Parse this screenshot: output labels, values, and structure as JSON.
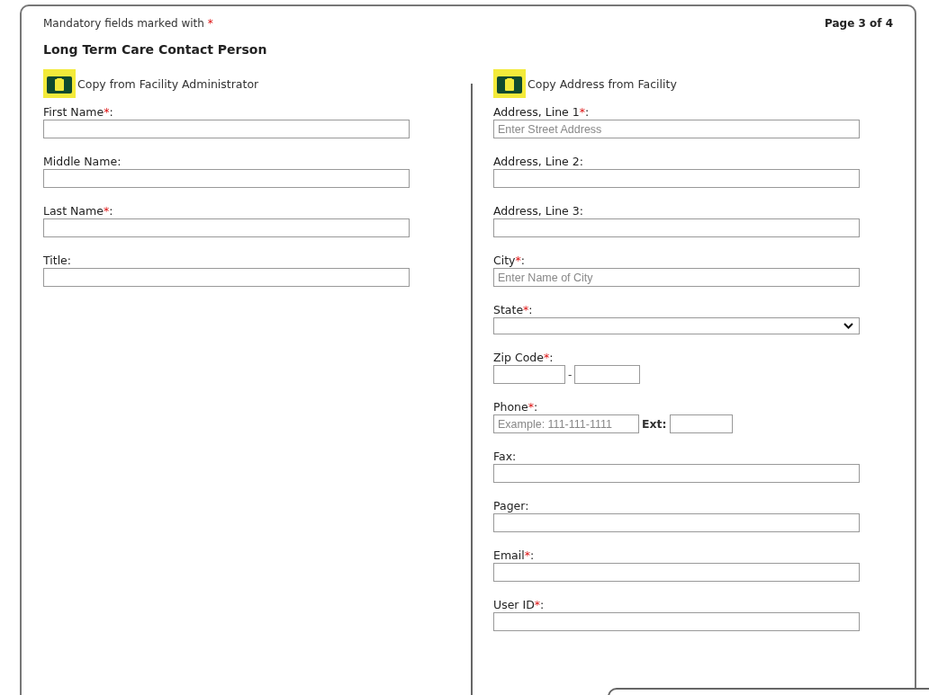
{
  "header": {
    "note": "Mandatory fields marked with",
    "note_mark": "*",
    "page": "Page 3 of 4"
  },
  "title": "Long Term Care Contact Person",
  "left": {
    "copy_button": "Copy from Facility Administrator",
    "fields": [
      {
        "kind": "text",
        "label": "First Name",
        "required_mark": "*",
        "colon": ":"
      },
      {
        "kind": "text",
        "label": "Middle Name:"
      },
      {
        "kind": "text",
        "label": "Last Name",
        "required_mark": "*",
        "colon": ":"
      },
      {
        "kind": "text",
        "label": "Title:"
      }
    ]
  },
  "right": {
    "copy_button": "Copy Address from Facility",
    "fields": [
      {
        "kind": "text",
        "label": "Address, Line 1",
        "required_mark": "*",
        "colon": ":",
        "placeholder": "Enter Street Address"
      },
      {
        "kind": "text",
        "label": "Address, Line 2:"
      },
      {
        "kind": "text",
        "label": "Address, Line 3:"
      },
      {
        "kind": "text",
        "label": "City",
        "required_mark": "*",
        "colon": ":",
        "placeholder": "Enter Name of City"
      },
      {
        "kind": "select",
        "label": "State",
        "required_mark": "*",
        "colon": ":"
      },
      {
        "kind": "zip",
        "label": "Zip Code",
        "required_mark": "*",
        "colon": ":",
        "separator": "-"
      },
      {
        "kind": "phone",
        "label": "Phone",
        "required_mark": "*",
        "colon": ":",
        "placeholder": "Example: 111-111-1111",
        "ext_label": "Ext:"
      },
      {
        "kind": "text",
        "label": "Fax:"
      },
      {
        "kind": "text",
        "label": "Pager:"
      },
      {
        "kind": "text",
        "label": "Email",
        "required_mark": "*",
        "colon": ":"
      },
      {
        "kind": "text",
        "label": "User ID",
        "required_mark": "*",
        "colon": ":"
      }
    ]
  }
}
